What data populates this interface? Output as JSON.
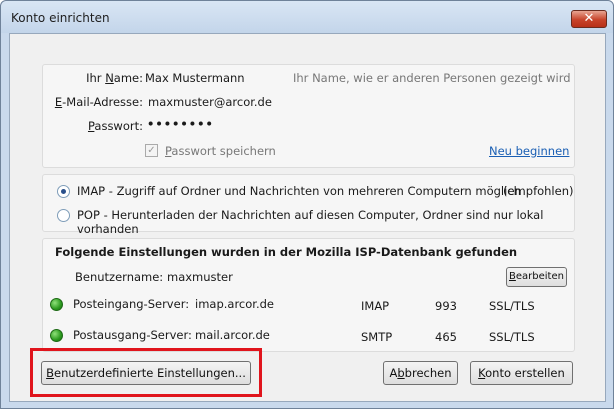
{
  "window": {
    "title": "Konto einrichten",
    "close_glyph": "✕"
  },
  "account": {
    "name_label_pre": "Ihr ",
    "name_label_mn": "N",
    "name_label_post": "ame:",
    "name_value": "Max Mustermann",
    "name_hint": "Ihr Name, wie er anderen Personen gezeigt wird",
    "email_label_mn": "E",
    "email_label_post": "-Mail-Adresse:",
    "email_value": "maxmuster@arcor.de",
    "password_label_mn": "P",
    "password_label_post": "asswort:",
    "password_value": "••••••••",
    "save_password_mn": "P",
    "save_password_post": "asswort speichern",
    "save_password_checked": true,
    "restart_link": "Neu beginnen"
  },
  "protocol": {
    "imap_label": "IMAP - Zugriff auf Ordner und Nachrichten von mehreren Computern möglich",
    "imap_recommended": "(empfohlen)",
    "imap_selected": true,
    "pop_label": "POP - Herunterladen der Nachrichten auf diesen Computer, Ordner sind nur lokal vorhanden",
    "pop_selected": false
  },
  "found": {
    "heading": "Folgende Einstellungen wurden in der Mozilla ISP-Datenbank gefunden",
    "username_label": "Benutzername:",
    "username_value": "maxmuster",
    "edit_button_mn": "B",
    "edit_button_post": "earbeiten",
    "incoming": {
      "label": "Posteingang-Server:",
      "host": "imap.arcor.de",
      "protocol": "IMAP",
      "port": "993",
      "security": "SSL/TLS",
      "status_color": "#2c9a1f"
    },
    "outgoing": {
      "label": "Postausgang-Server:",
      "host": "mail.arcor.de",
      "protocol": "SMTP",
      "port": "465",
      "security": "SSL/TLS",
      "status_color": "#2c9a1f"
    }
  },
  "buttons": {
    "custom_mn": "B",
    "custom_post": "enutzerdefinierte Einstellungen...",
    "cancel_pre": "A",
    "cancel_mn": "b",
    "cancel_post": "brechen",
    "create_mn": "K",
    "create_post": "onto erstellen"
  },
  "highlight_color": "#e0141c"
}
